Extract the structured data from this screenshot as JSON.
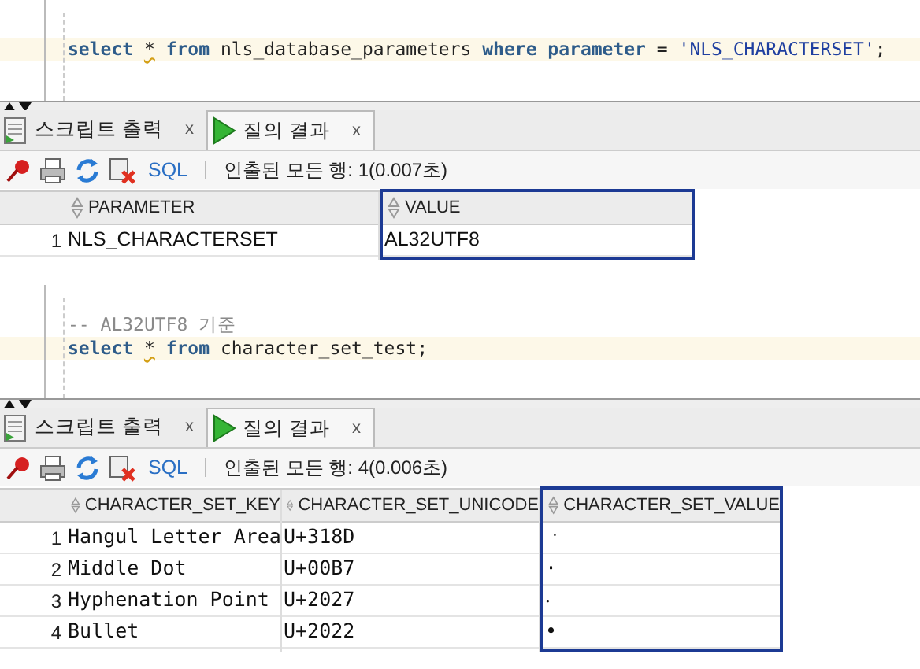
{
  "sections": [
    {
      "editor": {
        "lines": [
          {
            "current": true,
            "tokens": [
              {
                "kind": "keyword",
                "text": "select"
              },
              {
                "kind": "star",
                "text": "*",
                "space_before": true
              },
              {
                "kind": "keyword",
                "text": "from",
                "space_before": true
              },
              {
                "kind": "plain",
                "text": " nls_database_parameters "
              },
              {
                "kind": "keyword",
                "text": "where"
              },
              {
                "kind": "keyword",
                "text": "parameter",
                "space_before": true
              },
              {
                "kind": "plain",
                "text": " = "
              },
              {
                "kind": "string",
                "text": "'NLS_CHARACTERSET'"
              },
              {
                "kind": "plain",
                "text": ";"
              }
            ]
          }
        ]
      },
      "result_tabs": [
        {
          "kind": "script",
          "label": "스크립트 출력",
          "close": "x",
          "selected": false
        },
        {
          "kind": "query",
          "label": "질의 결과",
          "close": "x",
          "selected": true
        }
      ],
      "toolbar": {
        "sql_link": "SQL",
        "status": "인출된 모든 행: 1(0.007초)"
      },
      "grid": {
        "columns": [
          {
            "label": "PARAMETER",
            "highlighted": false
          },
          {
            "label": "VALUE",
            "highlighted": true
          }
        ],
        "rows": [
          {
            "number": "1",
            "cells": [
              "NLS_CHARACTERSET",
              "AL32UTF8"
            ]
          }
        ]
      }
    },
    {
      "editor": {
        "lines": [
          {
            "current": false,
            "tokens": [
              {
                "kind": "comment",
                "text": "-- AL32UTF8 기준"
              }
            ]
          },
          {
            "current": true,
            "tokens": [
              {
                "kind": "keyword",
                "text": "select"
              },
              {
                "kind": "star",
                "text": "*",
                "space_before": true
              },
              {
                "kind": "keyword",
                "text": "from",
                "space_before": true
              },
              {
                "kind": "plain",
                "text": " character_set_test;"
              }
            ]
          }
        ]
      },
      "result_tabs": [
        {
          "kind": "script",
          "label": "스크립트 출력",
          "close": "x",
          "selected": false
        },
        {
          "kind": "query",
          "label": "질의 결과",
          "close": "x",
          "selected": true
        }
      ],
      "toolbar": {
        "sql_link": "SQL",
        "status": "인출된 모든 행: 4(0.006초)"
      },
      "grid": {
        "columns": [
          {
            "label": "CHARACTER_SET_KEY",
            "highlighted": false
          },
          {
            "label": "CHARACTER_SET_UNICODE",
            "highlighted": false
          },
          {
            "label": "CHARACTER_SET_VALUE",
            "highlighted": true
          }
        ],
        "rows": [
          {
            "number": "1",
            "cells": [
              "Hangul Letter Area",
              "U+318D",
              "ㆍ"
            ]
          },
          {
            "number": "2",
            "cells": [
              "Middle Dot",
              "U+00B7",
              "·"
            ]
          },
          {
            "number": "3",
            "cells": [
              "Hyphenation Point",
              "U+2027",
              "‧"
            ]
          },
          {
            "number": "4",
            "cells": [
              "Bullet",
              "U+2022",
              "•"
            ]
          }
        ]
      }
    }
  ]
}
